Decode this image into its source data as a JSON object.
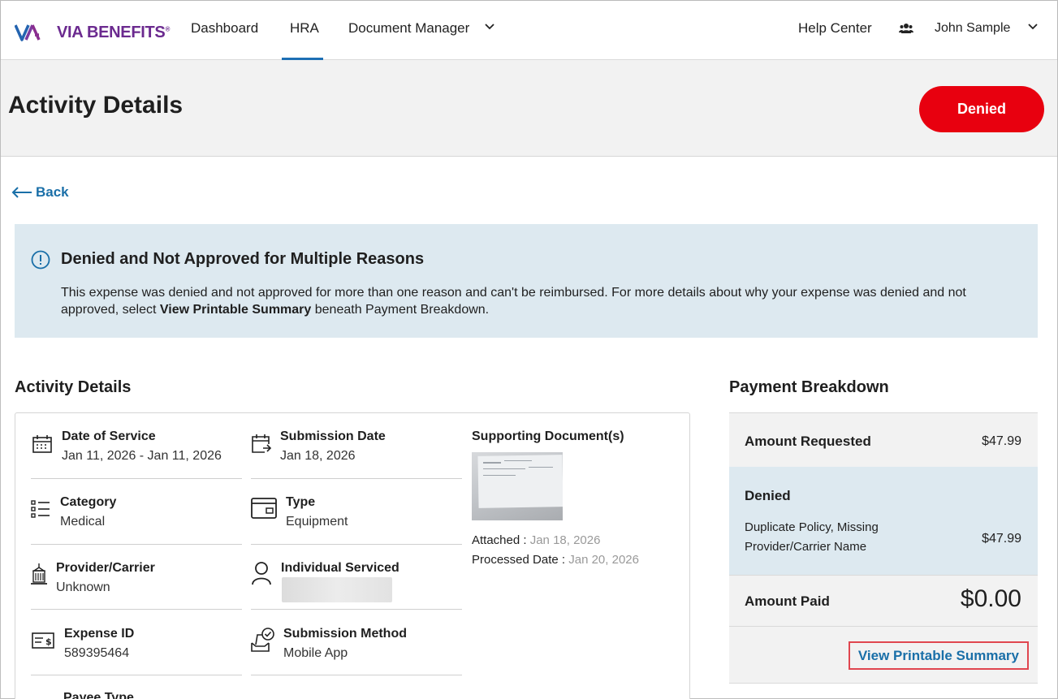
{
  "brand": {
    "name": "VIA BENEFITS",
    "mark": "®",
    "colors": {
      "purple": "#6b2a8f",
      "blue": "#2464b0"
    }
  },
  "nav": {
    "items": [
      {
        "label": "Dashboard"
      },
      {
        "label": "HRA"
      },
      {
        "label": "Document Manager"
      }
    ],
    "active": "HRA",
    "help": "Help Center",
    "user": "John Sample"
  },
  "page": {
    "title": "Activity Details",
    "status": "Denied",
    "status_color": "#e8000f",
    "back": "Back"
  },
  "alert": {
    "title": "Denied and Not Approved for Multiple Reasons",
    "body_pre": "This expense was denied and not approved for more than one reason and can't be reimbursed. For more details about why your expense was denied and not approved, select ",
    "body_bold": "View Printable Summary",
    "body_post": " beneath Payment Breakdown."
  },
  "details": {
    "heading": "Activity Details",
    "date_of_service": {
      "label": "Date of Service",
      "value": "Jan 11, 2026 - Jan 11, 2026"
    },
    "submission_date": {
      "label": "Submission Date",
      "value": "Jan 18, 2026"
    },
    "category": {
      "label": "Category",
      "value": "Medical"
    },
    "type": {
      "label": "Type",
      "value": "Equipment"
    },
    "provider": {
      "label": "Provider/Carrier",
      "value": "Unknown"
    },
    "individual": {
      "label": "Individual Serviced"
    },
    "expense_id": {
      "label": "Expense ID",
      "value": "589395464"
    },
    "submission_method": {
      "label": "Submission Method",
      "value": "Mobile App"
    },
    "payee_type": {
      "label": "Payee Type"
    },
    "documents": {
      "label": "Supporting Document(s)",
      "attached_label": "Attached :",
      "attached_value": "Jan 18, 2026",
      "processed_label": "Processed Date :",
      "processed_value": "Jan 20, 2026"
    }
  },
  "payment": {
    "heading": "Payment Breakdown",
    "requested_label": "Amount Requested",
    "requested_value": "$47.99",
    "denied_label": "Denied",
    "denied_reason": "Duplicate Policy, Missing Provider/Carrier Name",
    "denied_value": "$47.99",
    "paid_label": "Amount Paid",
    "paid_value": "$0.00",
    "summary_button": "View Printable Summary"
  }
}
